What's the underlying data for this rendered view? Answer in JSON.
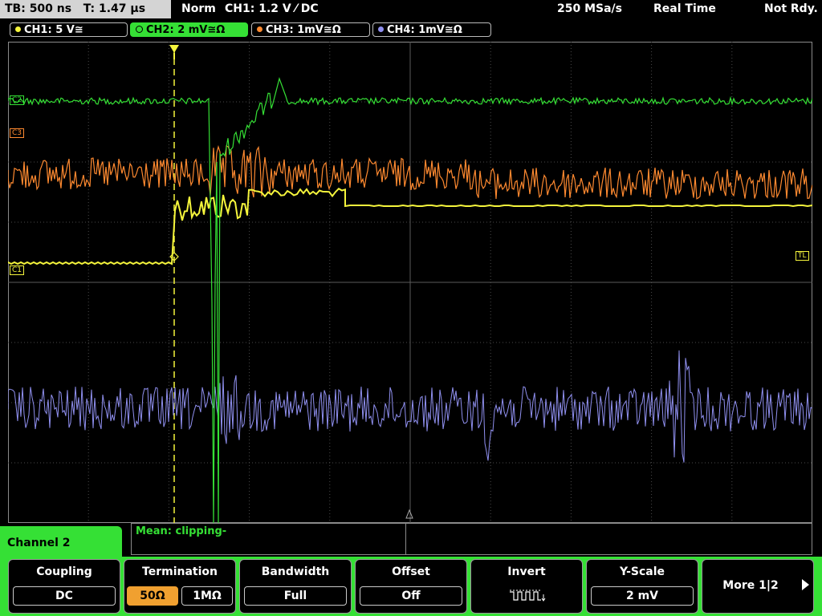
{
  "status": {
    "timebase": "TB: 500 ns",
    "trigger_time": "T: 1.47 µs",
    "mode": "Norm",
    "trigger_setting": "CH1: 1.2 V ⁄ DC",
    "sample_rate": "250 MSa/s",
    "acq_mode": "Real Time",
    "ready_state": "Not Rdy."
  },
  "channels": [
    {
      "label": "CH1: 5 V≅",
      "color": "#f5f53c"
    },
    {
      "label": "CH2: 2 mV≅Ω",
      "color": "#35e035"
    },
    {
      "label": "CH3: 1mV≅Ω",
      "color": "#ff8a30"
    },
    {
      "label": "CH4: 1mV≅Ω",
      "color": "#9090f0"
    }
  ],
  "markers": {
    "c2": "C2",
    "c3": "C3",
    "c1": "C1",
    "tl": "TL"
  },
  "measurement": "Mean: clipping-",
  "panel_title": "Channel 2",
  "softkeys": {
    "coupling": {
      "title": "Coupling",
      "value": "DC"
    },
    "termination": {
      "title": "Termination",
      "options": [
        "50Ω",
        "1MΩ"
      ],
      "selected": "50Ω"
    },
    "bandwidth": {
      "title": "Bandwidth",
      "value": "Full"
    },
    "offset": {
      "title": "Offset",
      "value": "Off"
    },
    "invert": {
      "title": "Invert",
      "icon": "inverted-square-wave-icon"
    },
    "yscale": {
      "title": "Y-Scale",
      "value": "2 mV"
    },
    "more": {
      "label": "More 1|2"
    }
  }
}
